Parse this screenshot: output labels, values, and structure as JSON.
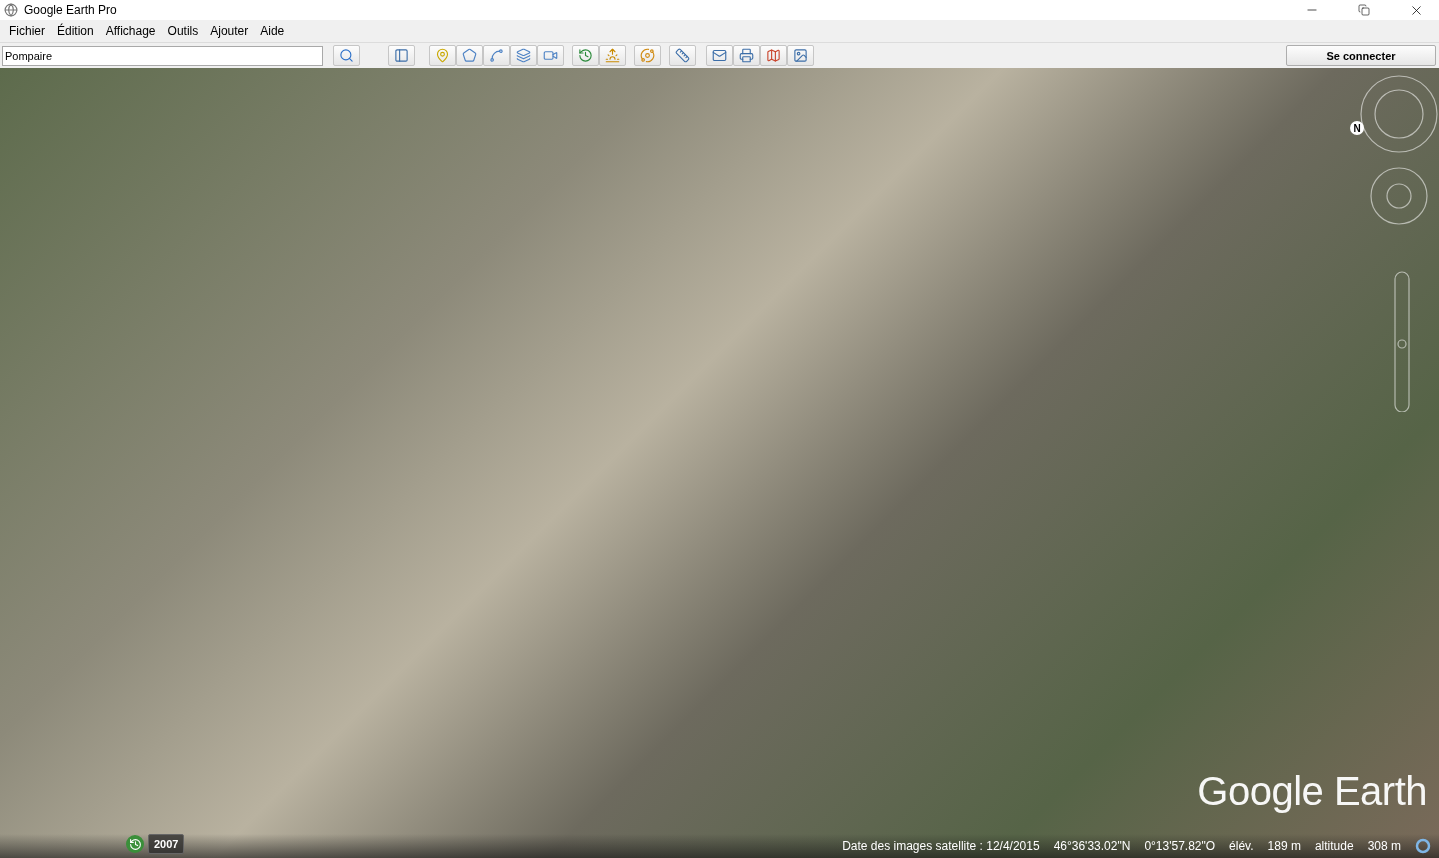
{
  "window": {
    "title": "Google Earth Pro"
  },
  "menu": [
    {
      "label": "Fichier"
    },
    {
      "label": "Édition"
    },
    {
      "label": "Affichage"
    },
    {
      "label": "Outils"
    },
    {
      "label": "Ajouter"
    },
    {
      "label": "Aide"
    }
  ],
  "search": {
    "value": "Pompaire"
  },
  "sign_in_button": "Se connecter",
  "map": {
    "compass_label": "N",
    "logo": "Google Earth",
    "historical_year": "2007",
    "status": {
      "date": "Date des images satellite : 12/4/2015",
      "latitude": "46°36'33.02\"N",
      "longitude": "0°13'57.82\"O",
      "elevation_label": "élév.",
      "elevation": "189 m",
      "altitude_label": "altitude",
      "altitude": "308 m"
    }
  }
}
